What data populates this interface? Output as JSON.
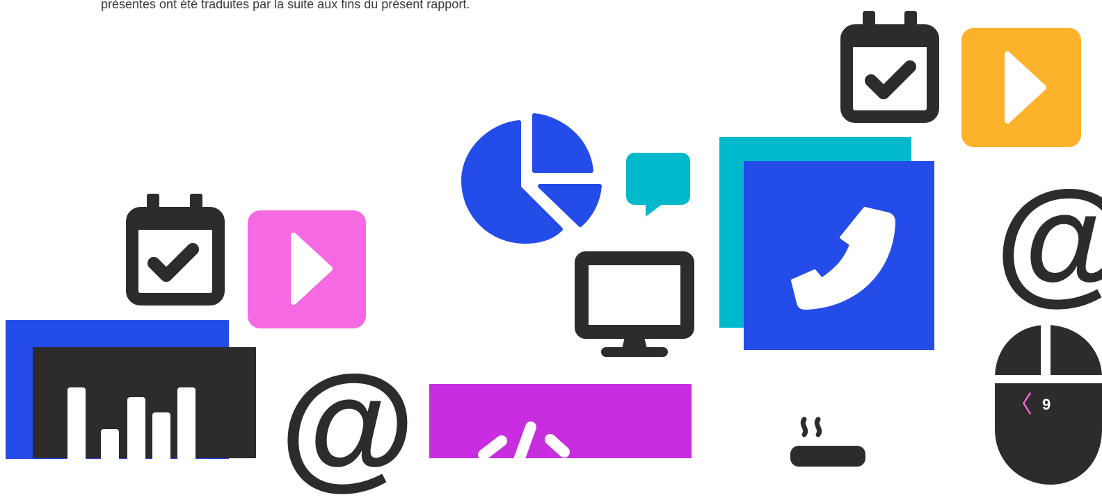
{
  "intro_text": "présentes ont été traduites par la suite aux fins du présent rapport.",
  "pagination": {
    "prev_symbol": "〈",
    "page_number": "9"
  },
  "colors": {
    "blue": "#234ce8",
    "dark": "#2e2b2c",
    "teal": "#00bacb",
    "pink": "#f56ae3",
    "orange": "#fdb22b",
    "magenta": "#c82ee0"
  },
  "icons": [
    "calendar-check-icon",
    "play-icon",
    "pie-chart-icon",
    "speech-bubble-icon",
    "phone-icon",
    "at-sign-icon",
    "computer-mouse-icon",
    "monitor-icon",
    "bar-chart-icon",
    "code-icon",
    "coffee-cup-icon"
  ]
}
